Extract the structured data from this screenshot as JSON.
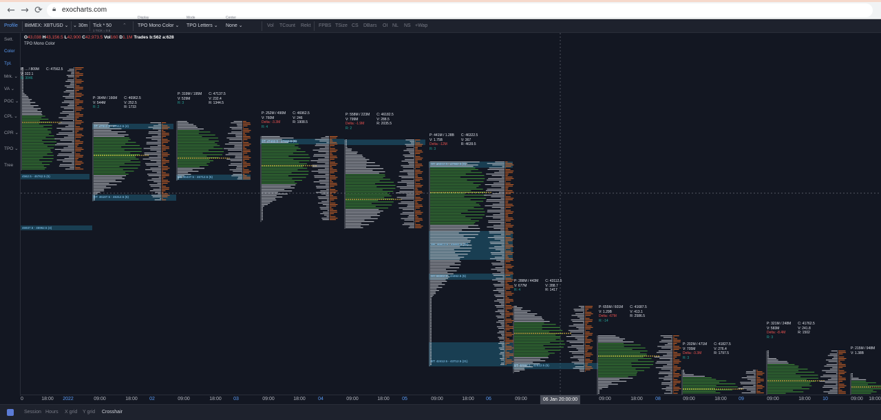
{
  "browser": {
    "url": "exocharts.com",
    "back_icon": "arrow-left-icon",
    "forward_icon": "arrow-right-icon",
    "reload_icon": "reload-icon"
  },
  "toolbar": {
    "profile": "Profile",
    "symbol": "BitMEX: XBTUSD",
    "timeframe": "30m",
    "tick": "Tick * 50",
    "tick_sub": "1 TICK = 0.5",
    "style_label": "Display",
    "style": "TPO Mono Color",
    "mode_label": "Mode",
    "mode": "TPO Letters",
    "centre_label": "Center",
    "centre": "None",
    "toggles": [
      "Vol",
      "TCount",
      "Rekt",
      "FPBS",
      "TSize",
      "CS",
      "DBars",
      "OI",
      "NL",
      "NS",
      "+Wap"
    ]
  },
  "sidebar": {
    "items": [
      "Sett.",
      "Color",
      "Tpl.",
      "Mrk.",
      "VA",
      "POC",
      "CPL",
      "CPR",
      "TPO",
      "Tree"
    ]
  },
  "info": {
    "o_label": "O",
    "o_value": "43,038",
    "h_label": "H",
    "h_value": "43,156.5",
    "l_label": "L",
    "l_value": "42,900",
    "c_label": "C",
    "c_value": "42,973.5",
    "vol_label": "Vol",
    "vol_value": "160",
    "d_label": "D",
    "d_value": "1.1M",
    "trades": "Trades b:562 a:628",
    "sub": "TPO Mono Color"
  },
  "time_axis": {
    "ticks": [
      "0",
      "18:00",
      "2022",
      "09:00",
      "18:00",
      "02",
      "09:00",
      "18:00",
      "03",
      "09:00",
      "18:00",
      "04",
      "09:00",
      "18:00",
      "05",
      "09:00",
      "18:00",
      "06",
      "09:00",
      "09:00",
      "18:00",
      "08",
      "09:00",
      "18:00",
      "09",
      "09:00",
      "18:00",
      "10",
      "09:00",
      "18:00"
    ],
    "crosshair": "06 Jan 20:00:00"
  },
  "bottom_bar": {
    "items": [
      "Session",
      "Hours",
      "X grid",
      "Y grid",
      "Crosshair"
    ]
  },
  "colors": {
    "background": "#131722",
    "tpo_green": "#3d8b37",
    "tpo_white": "#c9cbd1",
    "volume_orange": "#d9692a",
    "value_area": "#1f5f7a",
    "poc": "#f0c341"
  },
  "profiles": [
    {
      "stats": [
        "P: ... / 809M",
        "V: 322.1",
        "R: 3046"
      ],
      "lines": [
        "C: 47562.5",
        "",
        ""
      ]
    },
    {
      "stats": [
        "P: 364M / 166M",
        "V: 544M",
        "R: 2"
      ],
      "lines": [
        "C: 46962.5",
        "V: 252.5",
        "R: 1733"
      ]
    },
    {
      "stats": [
        "P: 319M / 195M",
        "V: 529M",
        "R: 3"
      ],
      "lines": [
        "C: 47137.5",
        "V: 232.4",
        "R: 1344.5"
      ]
    },
    {
      "stats": [
        "P: 252M / 490M",
        "V: 760M",
        "Delta: -3.3M",
        "R: 4"
      ],
      "lines": [
        "C: 46962.5",
        "V: 246",
        "R: 1908.5"
      ]
    },
    {
      "stats": [
        "P: 558M / 223M",
        "V: 799M",
        "Delta: -1.9M",
        "R: 2"
      ],
      "lines": [
        "C: 46182.5",
        "V: 288.5",
        "R: 2035.5"
      ]
    },
    {
      "stats": [
        "P: 441M / 1.28B",
        "V: 1.75B",
        "Delta: -12M",
        "R: 3"
      ],
      "lines": [
        "C: 46322.5",
        "V: 367",
        "R: 4639.5"
      ]
    },
    {
      "stats": [
        "P: 288M / 443M",
        "V: 677M",
        "R: 4"
      ],
      "lines": [
        "C: 43112.5",
        "V: 288.7",
        "R: 1417"
      ]
    },
    {
      "stats": [
        "P: 655M / 601M",
        "V: 1.29B",
        "Delta: -67M",
        "R: -14"
      ],
      "lines": [
        "C: 41687.5",
        "V: 413.1",
        "R: 2586.5"
      ]
    },
    {
      "stats": [
        "P: 202M / 471M",
        "V: 705M",
        "Delta: -3.3M",
        "R: 3"
      ],
      "lines": [
        "C: 41827.5",
        "V: 276.4",
        "R: 1797.5"
      ]
    },
    {
      "stats": [
        "P: 321M / 248M",
        "V: 583M",
        "Delta: -8.4M",
        "R: 3"
      ],
      "lines": [
        "C: 41762.5",
        "V: 241.8",
        "R: 1502"
      ]
    },
    {
      "stats": [
        "P: 215M / 948M",
        "V: 1.38B",
        "",
        ""
      ],
      "lines": [
        "",
        "",
        ""
      ]
    }
  ],
  "value_labels": [
    "ST: 47612.5 - 47512.5 (4)",
    "BT: 46187.5 - 46312.5 (5)",
    "BT: 46437.5 - 46712.5 (5)",
    "ST: 47462.5 - 47662.5 (5)",
    "ST: 46312.5 - 47562.5 (5)",
    "SR: 46812.5 - 45462.5 (27)",
    "ST: 44362.5 - 44462.5 (5)",
    "BT: 42412.5 - 43712.5 (21)",
    "BT: 42112.5 - 42512.5 (5)",
    "4562.5 - 46762.5 (5)",
    "46937.5 - 45962.5 (4)"
  ]
}
